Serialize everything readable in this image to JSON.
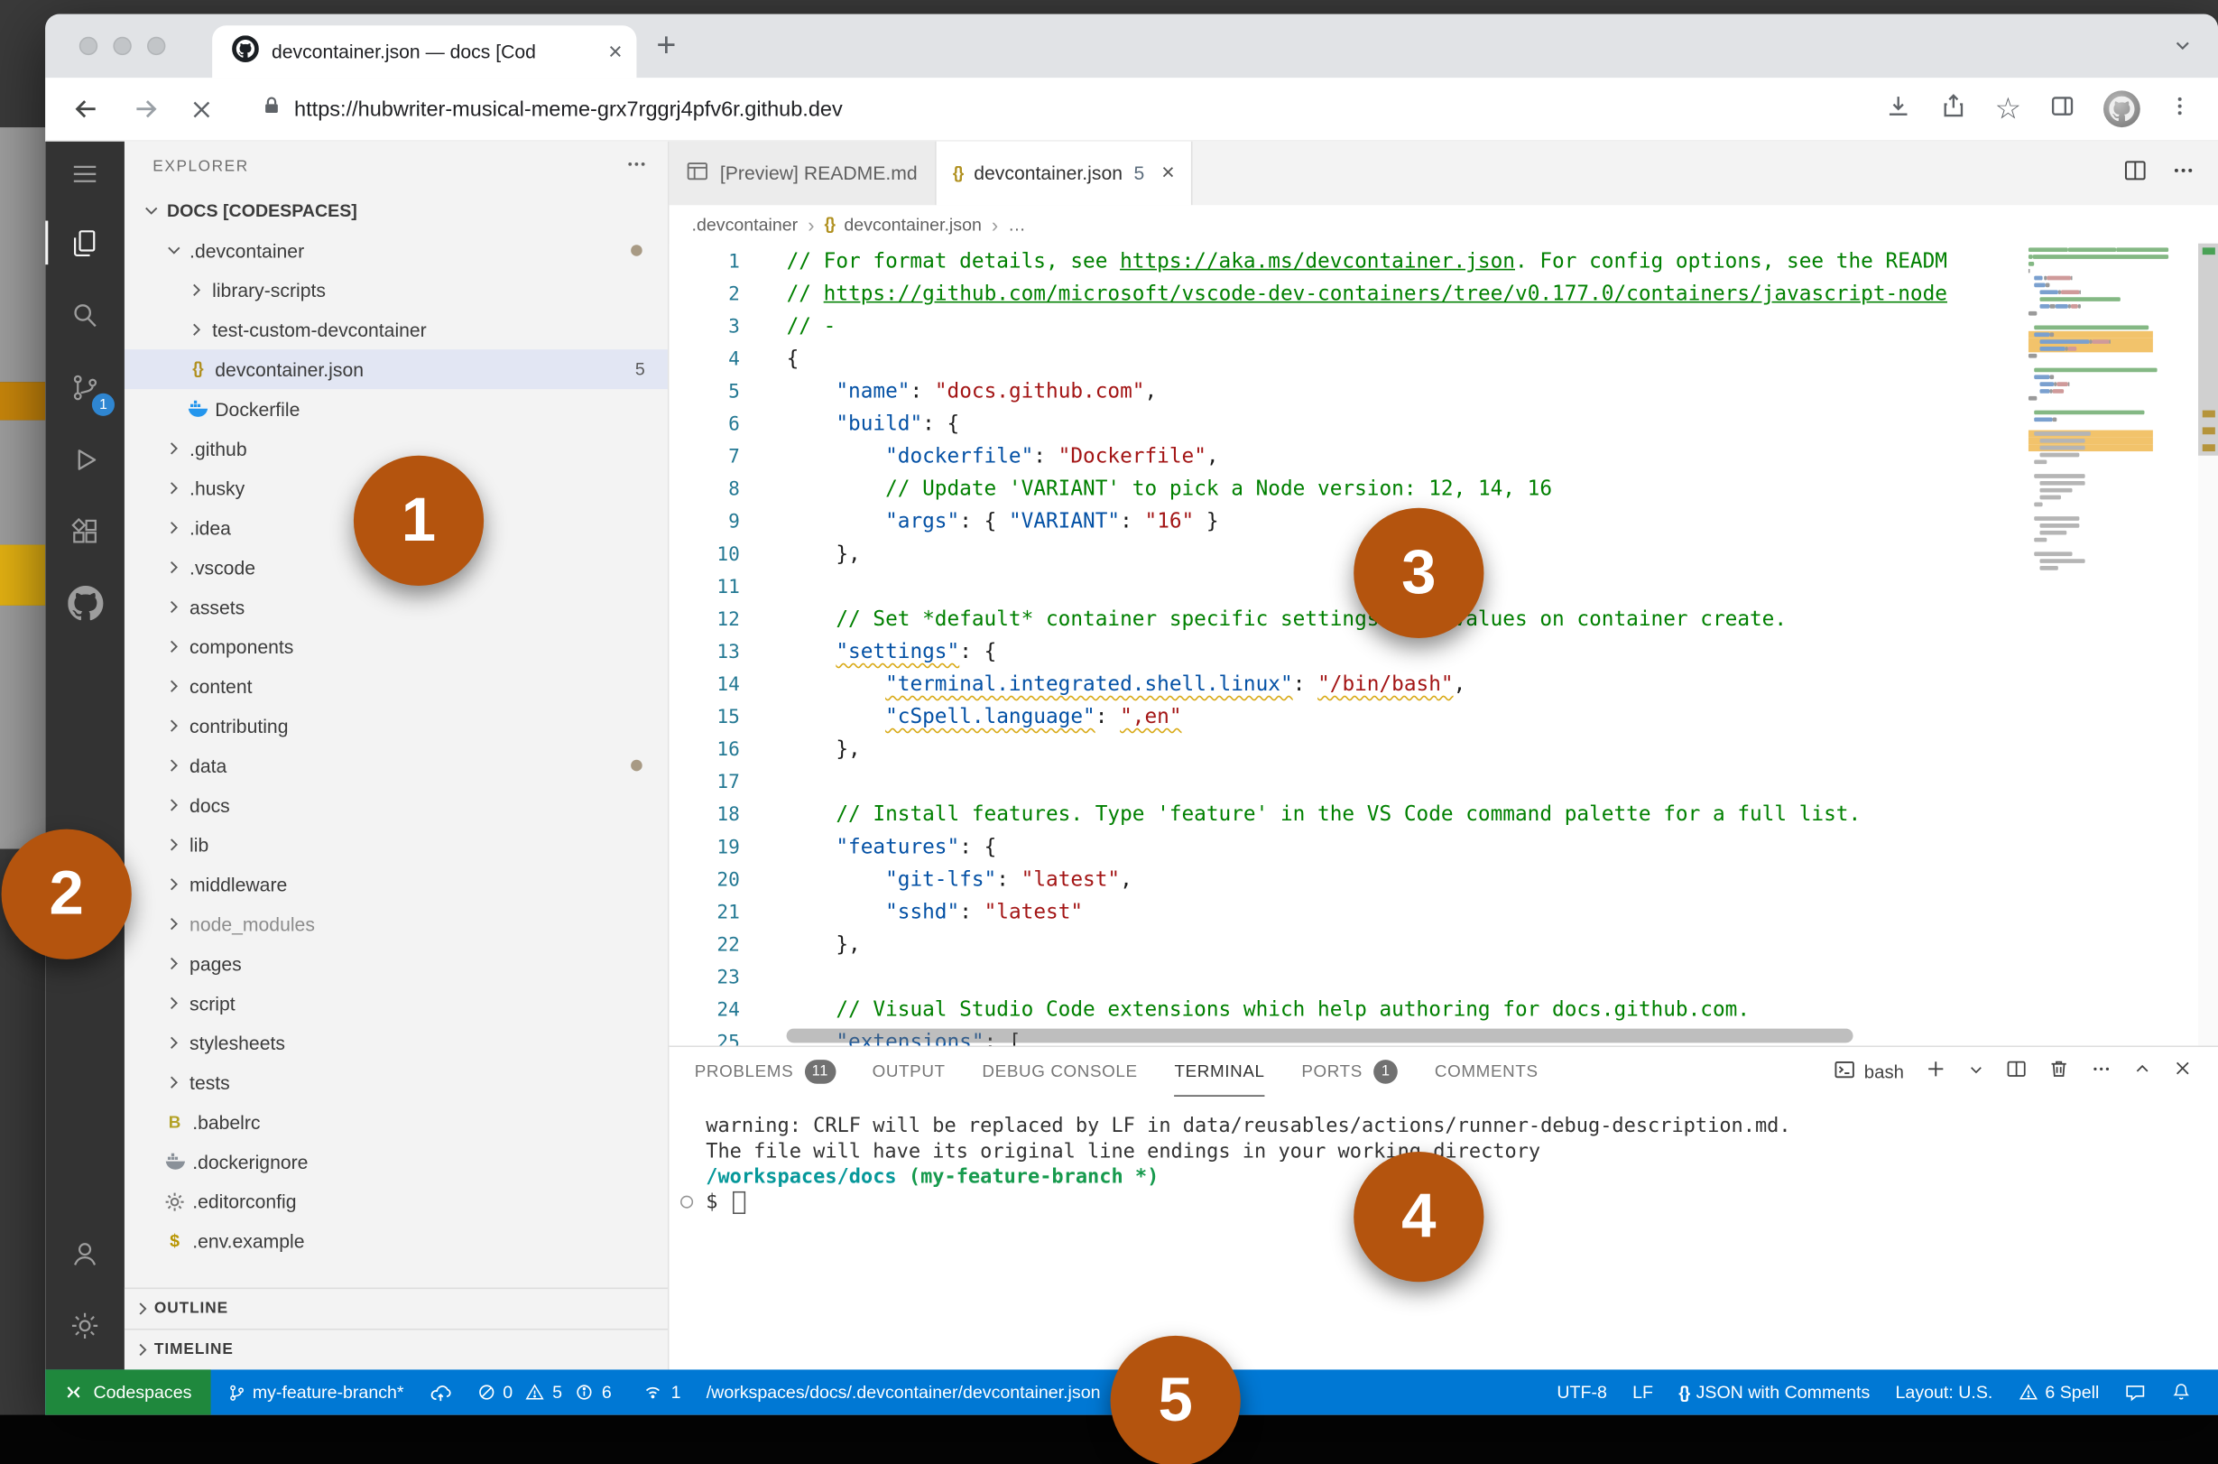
{
  "colors": {
    "status_bar_blue": "#0078d4",
    "codespaces_green": "#1f883d",
    "callout_orange": "#b4540e",
    "comment_green": "#008000",
    "key_blue": "#0451a5",
    "string_red": "#a31515"
  },
  "browser": {
    "tab_title": "devcontainer.json — docs [Cod",
    "url": "https://hubwriter-musical-meme-grx7rggrj4pfv6r.github.dev"
  },
  "activity_bar": {
    "source_control_badge": "1"
  },
  "explorer": {
    "title": "EXPLORER",
    "items": [
      {
        "label": "DOCS [CODESPACES]",
        "indent": 0,
        "chevron": "down",
        "root": true
      },
      {
        "label": ".devcontainer",
        "indent": 1,
        "chevron": "down",
        "dot": true
      },
      {
        "label": "library-scripts",
        "indent": 2,
        "chevron": "right"
      },
      {
        "label": "test-custom-devcontainer",
        "indent": 2,
        "chevron": "right"
      },
      {
        "label": "devcontainer.json",
        "indent": 2,
        "icon": "json",
        "badge": "5",
        "selected": true
      },
      {
        "label": "Dockerfile",
        "indent": 2,
        "icon": "docker"
      },
      {
        "label": ".github",
        "indent": 1,
        "chevron": "right"
      },
      {
        "label": ".husky",
        "indent": 1,
        "chevron": "right"
      },
      {
        "label": ".idea",
        "indent": 1,
        "chevron": "right"
      },
      {
        "label": ".vscode",
        "indent": 1,
        "chevron": "right"
      },
      {
        "label": "assets",
        "indent": 1,
        "chevron": "right"
      },
      {
        "label": "components",
        "indent": 1,
        "chevron": "right"
      },
      {
        "label": "content",
        "indent": 1,
        "chevron": "right"
      },
      {
        "label": "contributing",
        "indent": 1,
        "chevron": "right"
      },
      {
        "label": "data",
        "indent": 1,
        "chevron": "right",
        "dot": true
      },
      {
        "label": "docs",
        "indent": 1,
        "chevron": "right"
      },
      {
        "label": "lib",
        "indent": 1,
        "chevron": "right"
      },
      {
        "label": "middleware",
        "indent": 1,
        "chevron": "right"
      },
      {
        "label": "node_modules",
        "indent": 1,
        "chevron": "right",
        "muted": true
      },
      {
        "label": "pages",
        "indent": 1,
        "chevron": "right"
      },
      {
        "label": "script",
        "indent": 1,
        "chevron": "right"
      },
      {
        "label": "stylesheets",
        "indent": 1,
        "chevron": "right"
      },
      {
        "label": "tests",
        "indent": 1,
        "chevron": "right"
      },
      {
        "label": ".babelrc",
        "indent": 1,
        "icon": "babel"
      },
      {
        "label": ".dockerignore",
        "indent": 1,
        "icon": "docker-gray"
      },
      {
        "label": ".editorconfig",
        "indent": 1,
        "icon": "gear"
      },
      {
        "label": ".env.example",
        "indent": 1,
        "icon": "env"
      }
    ],
    "sections": [
      {
        "label": "OUTLINE"
      },
      {
        "label": "TIMELINE"
      }
    ]
  },
  "editor": {
    "tabs": [
      {
        "label": "[Preview] README.md",
        "active": false
      },
      {
        "label": "devcontainer.json",
        "badge": "5",
        "active": true
      }
    ],
    "breadcrumbs": [
      ".devcontainer",
      "devcontainer.json",
      "…"
    ],
    "code_lines": [
      {
        "segs": [
          {
            "c": "cm",
            "t": "// For format details, see "
          },
          {
            "c": "cm lnk",
            "t": "https://aka.ms/devcontainer.json"
          },
          {
            "c": "cm",
            "t": ". For config options, see the READM"
          }
        ]
      },
      {
        "segs": [
          {
            "c": "cm",
            "t": "// "
          },
          {
            "c": "cm lnk",
            "t": "https://github.com/microsoft/vscode-dev-containers/tree/v0.177.0/containers/javascript-node"
          }
        ]
      },
      {
        "segs": [
          {
            "c": "cm",
            "t": "// -"
          }
        ]
      },
      {
        "segs": [
          {
            "c": "pun",
            "t": "{"
          }
        ]
      },
      {
        "segs": [
          {
            "c": "pun",
            "t": "    "
          },
          {
            "c": "key",
            "t": "\"name\""
          },
          {
            "c": "pun",
            "t": ": "
          },
          {
            "c": "str",
            "t": "\"docs.github.com\""
          },
          {
            "c": "pun",
            "t": ","
          }
        ]
      },
      {
        "segs": [
          {
            "c": "pun",
            "t": "    "
          },
          {
            "c": "key",
            "t": "\"build\""
          },
          {
            "c": "pun",
            "t": ": {"
          }
        ]
      },
      {
        "segs": [
          {
            "c": "pun",
            "t": "        "
          },
          {
            "c": "key",
            "t": "\"dockerfile\""
          },
          {
            "c": "pun",
            "t": ": "
          },
          {
            "c": "str",
            "t": "\"Dockerfile\""
          },
          {
            "c": "pun",
            "t": ","
          }
        ]
      },
      {
        "segs": [
          {
            "c": "pun",
            "t": "        "
          },
          {
            "c": "cm",
            "t": "// Update 'VARIANT' to pick a Node version: 12, 14, 16"
          }
        ]
      },
      {
        "segs": [
          {
            "c": "pun",
            "t": "        "
          },
          {
            "c": "key",
            "t": "\"args\""
          },
          {
            "c": "pun",
            "t": ": { "
          },
          {
            "c": "key",
            "t": "\"VARIANT\""
          },
          {
            "c": "pun",
            "t": ": "
          },
          {
            "c": "str",
            "t": "\"16\""
          },
          {
            "c": "pun",
            "t": " }"
          }
        ]
      },
      {
        "segs": [
          {
            "c": "pun",
            "t": "    },"
          }
        ]
      },
      {
        "segs": []
      },
      {
        "segs": [
          {
            "c": "pun",
            "t": "    "
          },
          {
            "c": "cm",
            "t": "// Set *default* container specific settings.json values on container create."
          }
        ]
      },
      {
        "segs": [
          {
            "c": "pun",
            "t": "    "
          },
          {
            "c": "key sq",
            "t": "\"settings\""
          },
          {
            "c": "pun",
            "t": ": {"
          }
        ]
      },
      {
        "segs": [
          {
            "c": "pun",
            "t": "        "
          },
          {
            "c": "key sq",
            "t": "\"terminal.integrated.shell.linux\""
          },
          {
            "c": "pun",
            "t": ": "
          },
          {
            "c": "str sq",
            "t": "\"/bin/bash\""
          },
          {
            "c": "pun",
            "t": ","
          }
        ]
      },
      {
        "segs": [
          {
            "c": "pun",
            "t": "        "
          },
          {
            "c": "key sq",
            "t": "\"cSpell.language\""
          },
          {
            "c": "pun",
            "t": ": "
          },
          {
            "c": "str sq",
            "t": "\",en\""
          }
        ]
      },
      {
        "segs": [
          {
            "c": "pun",
            "t": "    },"
          }
        ]
      },
      {
        "segs": []
      },
      {
        "segs": [
          {
            "c": "pun",
            "t": "    "
          },
          {
            "c": "cm",
            "t": "// Install features. Type 'feature' in the VS Code command palette for a full list."
          }
        ]
      },
      {
        "segs": [
          {
            "c": "pun",
            "t": "    "
          },
          {
            "c": "key",
            "t": "\"features\""
          },
          {
            "c": "pun",
            "t": ": {"
          }
        ]
      },
      {
        "segs": [
          {
            "c": "pun",
            "t": "        "
          },
          {
            "c": "key",
            "t": "\"git-lfs\""
          },
          {
            "c": "pun",
            "t": ": "
          },
          {
            "c": "str",
            "t": "\"latest\""
          },
          {
            "c": "pun",
            "t": ","
          }
        ]
      },
      {
        "segs": [
          {
            "c": "pun",
            "t": "        "
          },
          {
            "c": "key",
            "t": "\"sshd\""
          },
          {
            "c": "pun",
            "t": ": "
          },
          {
            "c": "str",
            "t": "\"latest\""
          }
        ]
      },
      {
        "segs": [
          {
            "c": "pun",
            "t": "    },"
          }
        ]
      },
      {
        "segs": []
      },
      {
        "segs": [
          {
            "c": "pun",
            "t": "    "
          },
          {
            "c": "cm",
            "t": "// Visual Studio Code extensions which help authoring for docs.github.com."
          }
        ]
      },
      {
        "segs": [
          {
            "c": "pun",
            "t": "    "
          },
          {
            "c": "key",
            "t": "\"extensions\""
          },
          {
            "c": "pun",
            "t": ": ["
          }
        ]
      }
    ]
  },
  "panel": {
    "tabs": [
      {
        "label": "PROBLEMS",
        "badge": "11"
      },
      {
        "label": "OUTPUT"
      },
      {
        "label": "DEBUG CONSOLE"
      },
      {
        "label": "TERMINAL",
        "active": true
      },
      {
        "label": "PORTS",
        "badge": "1"
      },
      {
        "label": "COMMENTS"
      }
    ],
    "shell_label": "bash"
  },
  "terminal": {
    "lines": [
      {
        "segs": [
          {
            "c": "t-def",
            "t": "warning: CRLF will be replaced by LF in data/reusables/actions/runner-debug-description.md."
          }
        ]
      },
      {
        "segs": [
          {
            "c": "t-def",
            "t": "The file will have its original line endings in your working directory"
          }
        ]
      },
      {
        "segs": [
          {
            "c": "t-path",
            "t": "/workspaces/docs"
          },
          {
            "c": "t-def",
            "t": " "
          },
          {
            "c": "t-branch",
            "t": "(my-feature-branch *)"
          }
        ]
      },
      {
        "prompt": true,
        "cursor": true,
        "segs": [
          {
            "c": "t-def",
            "t": "$ "
          }
        ]
      }
    ]
  },
  "status_bar": {
    "left": [
      {
        "id": "codespaces",
        "icon": "remote",
        "label": "Codespaces"
      },
      {
        "id": "branch",
        "icon": "branch",
        "label": "my-feature-branch*"
      },
      {
        "id": "sync",
        "icon": "sync",
        "label": ""
      },
      {
        "id": "problems",
        "items": [
          {
            "icon": "error",
            "label": "0"
          },
          {
            "icon": "warning",
            "label": "5"
          },
          {
            "icon": "info",
            "label": "6"
          }
        ]
      },
      {
        "id": "ports",
        "icon": "broadcast",
        "label": "1"
      },
      {
        "id": "path",
        "label": "/workspaces/docs/.devcontainer/devcontainer.json"
      }
    ],
    "right": [
      {
        "id": "encoding",
        "label": "UTF-8"
      },
      {
        "id": "eol",
        "label": "LF"
      },
      {
        "id": "language",
        "icon": "braces",
        "label": "JSON with Comments"
      },
      {
        "id": "layout",
        "label": "Layout: U.S."
      },
      {
        "id": "spell",
        "icon": "warning",
        "label": "6 Spell"
      },
      {
        "id": "feedback",
        "icon": "feedback",
        "label": ""
      },
      {
        "id": "notifications",
        "icon": "bell",
        "label": ""
      }
    ]
  },
  "callouts": [
    {
      "n": "1"
    },
    {
      "n": "2"
    },
    {
      "n": "3"
    },
    {
      "n": "4"
    },
    {
      "n": "5"
    }
  ]
}
